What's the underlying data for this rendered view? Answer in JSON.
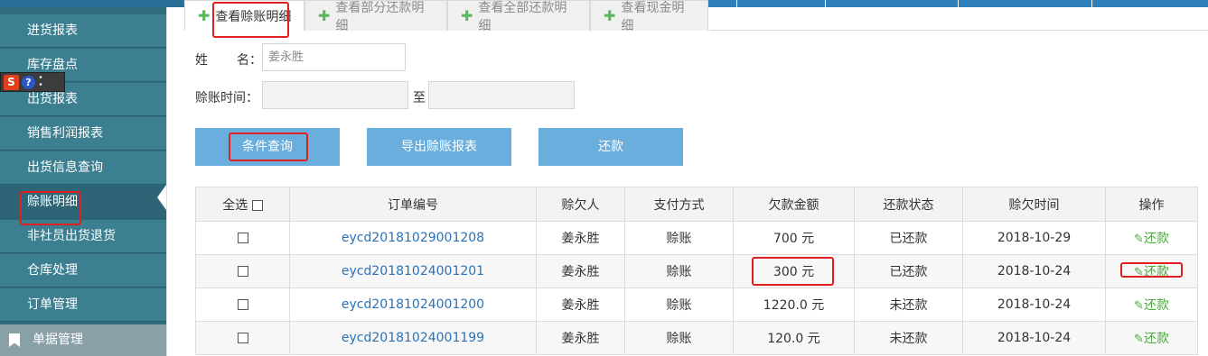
{
  "sidebar": {
    "items": [
      {
        "label": "进货报表"
      },
      {
        "label": "库存盘点"
      },
      {
        "label": "出货报表"
      },
      {
        "label": "销售利润报表"
      },
      {
        "label": "出货信息查询"
      },
      {
        "label": "赊账明细"
      },
      {
        "label": "非社员出货退货"
      },
      {
        "label": "仓库处理"
      },
      {
        "label": "订单管理"
      }
    ],
    "section_label": "单据管理",
    "section_icon": "bookmark-icon"
  },
  "ime_toolbar": {
    "s_label": "S",
    "help_label": "?"
  },
  "tabs": [
    {
      "label": "查看赊账明细"
    },
    {
      "label": "查看部分还款明细"
    },
    {
      "label": "查看全部还款明细"
    },
    {
      "label": "查看现金明细"
    }
  ],
  "form": {
    "name_label_1": "姓",
    "name_label_2": "名：",
    "name_value": "姜永胜",
    "time_label": "赊账时间：",
    "to_label": "至",
    "date_from": "",
    "date_to": ""
  },
  "buttons": {
    "query": "条件查询",
    "export": "导出赊账报表",
    "repay": "还款"
  },
  "table": {
    "select_all": "全选",
    "headers": [
      "订单编号",
      "赊欠人",
      "支付方式",
      "欠款金额",
      "还款状态",
      "赊欠时间",
      "操作"
    ],
    "rows": [
      {
        "order": "eycd20181029001208",
        "debtor": "姜永胜",
        "method": "赊账",
        "amount": "700 元",
        "status": "已还款",
        "date": "2018-10-29",
        "action": "还款"
      },
      {
        "order": "eycd20181024001201",
        "debtor": "姜永胜",
        "method": "赊账",
        "amount": "300 元",
        "status": "已还款",
        "date": "2018-10-24",
        "action": "还款"
      },
      {
        "order": "eycd20181024001200",
        "debtor": "姜永胜",
        "method": "赊账",
        "amount": "1220.0 元",
        "status": "未还款",
        "date": "2018-10-24",
        "action": "还款"
      },
      {
        "order": "eycd20181024001199",
        "debtor": "姜永胜",
        "method": "赊账",
        "amount": "120.0 元",
        "status": "未还款",
        "date": "2018-10-24",
        "action": "还款"
      }
    ]
  },
  "colors": {
    "sidebar_bg": "#3b7f91",
    "button_bg": "#6aaedd",
    "link": "#2a72b5",
    "action_green": "#4aa83c",
    "annotation_red": "#e02020"
  }
}
